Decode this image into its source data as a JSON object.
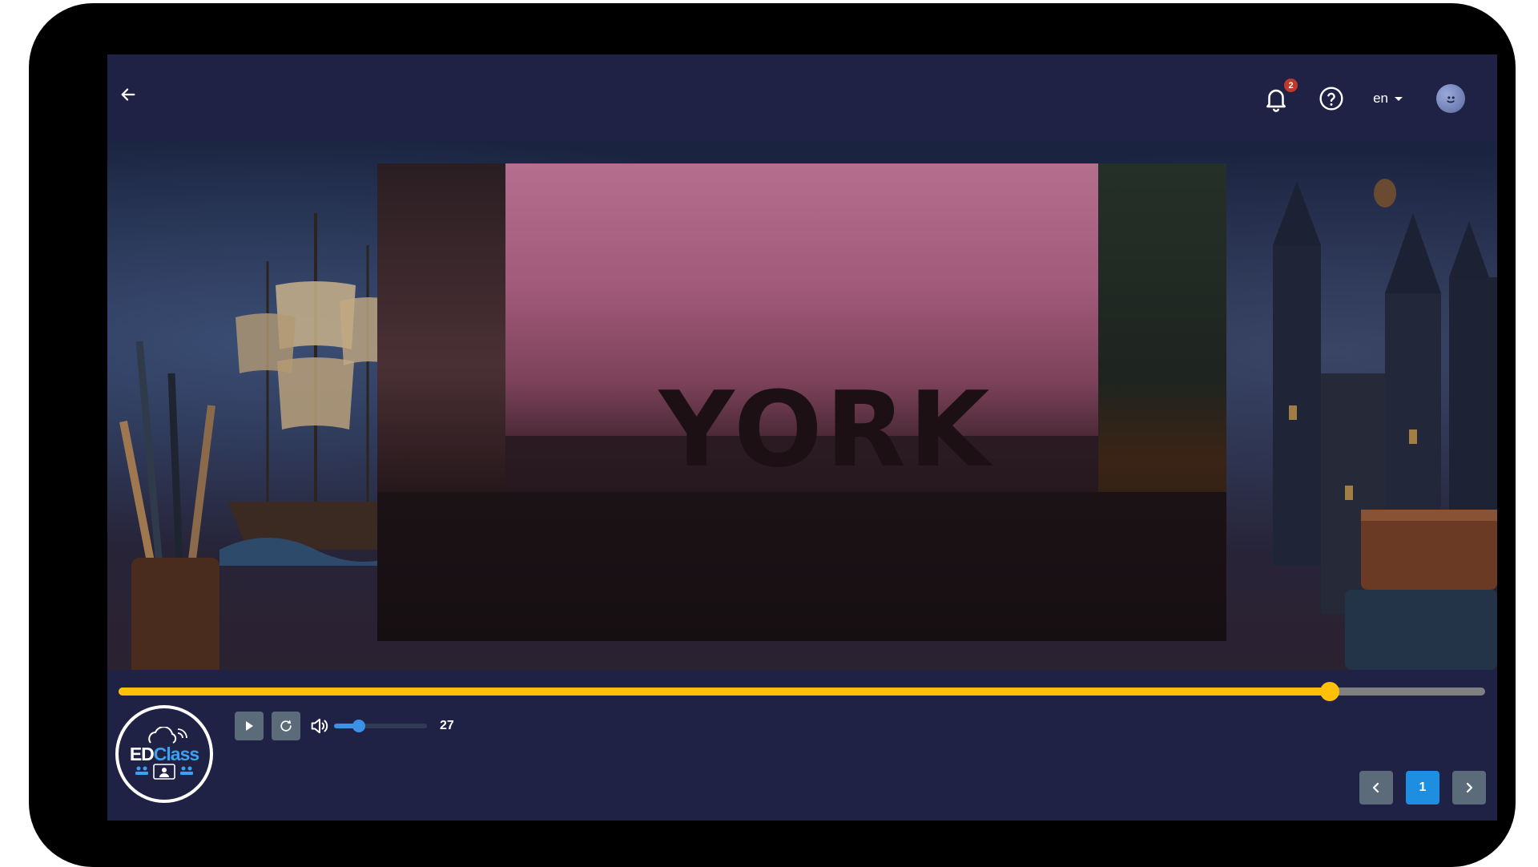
{
  "header": {
    "notifications_count": "2",
    "language": "en"
  },
  "slide": {
    "title": "YORK"
  },
  "player": {
    "progress_fraction": 0.886,
    "volume_value": "27",
    "volume_fraction": 0.27
  },
  "logo": {
    "text_ed": "ED",
    "text_class": "Class"
  },
  "pagination": {
    "current_page": "1"
  },
  "icons": {
    "back": "arrow-left-icon",
    "notifications": "bell-icon",
    "help": "question-circle-icon",
    "language": "caret-down-icon",
    "play": "play-icon",
    "replay": "replay-icon",
    "volume": "volume-icon",
    "prev": "chevron-left-icon",
    "next": "chevron-right-icon"
  },
  "colors": {
    "accent_progress": "#ffc107",
    "accent_volume": "#3b91e5",
    "badge": "#c0392b",
    "panel": "#1f2244"
  }
}
